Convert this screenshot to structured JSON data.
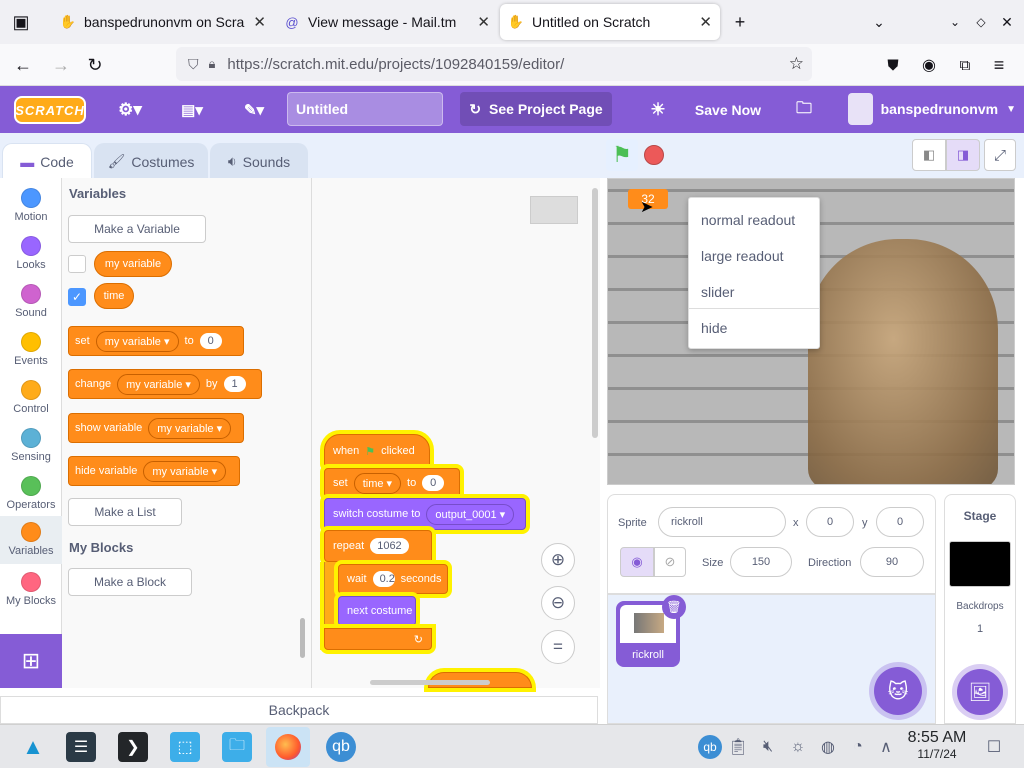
{
  "browser": {
    "tabs": [
      {
        "label": "banspedrunonvm on Scra",
        "icon": "scratch-tab-icon",
        "active": false
      },
      {
        "label": "View message - Mail.tm",
        "icon": "mail-tab-icon",
        "active": false
      },
      {
        "label": "Untitled on Scratch",
        "icon": "scratch-tab-icon",
        "active": true
      }
    ],
    "url": "https://scratch.mit.edu/projects/1092840159/editor/"
  },
  "menubar": {
    "logo": "SCRATCH",
    "project_title": "Untitled",
    "see_project_page": "See Project Page",
    "save_now": "Save Now",
    "username": "banspedrunonvm"
  },
  "editor_tabs": [
    "Code",
    "Costumes",
    "Sounds"
  ],
  "categories": [
    {
      "label": "Motion",
      "color": "#4c97ff"
    },
    {
      "label": "Looks",
      "color": "#9966ff"
    },
    {
      "label": "Sound",
      "color": "#cf63cf"
    },
    {
      "label": "Events",
      "color": "#ffbf00"
    },
    {
      "label": "Control",
      "color": "#ffab19"
    },
    {
      "label": "Sensing",
      "color": "#5cb1d6"
    },
    {
      "label": "Operators",
      "color": "#59c059"
    },
    {
      "label": "Variables",
      "color": "#ff8c1a"
    },
    {
      "label": "My Blocks",
      "color": "#ff6680"
    }
  ],
  "palette": {
    "variables_heading": "Variables",
    "make_variable": "Make a Variable",
    "var1": "my variable",
    "var2": "time",
    "set_block": {
      "word": "set",
      "var": "my variable",
      "to": "to",
      "value": "0"
    },
    "change_block": {
      "word": "change",
      "var": "my variable",
      "by": "by",
      "value": "1"
    },
    "show_block": {
      "word": "show variable",
      "var": "my variable"
    },
    "hide_block": {
      "word": "hide variable",
      "var": "my variable"
    },
    "make_list": "Make a List",
    "myblocks_heading": "My Blocks",
    "make_block": "Make a Block"
  },
  "script": {
    "when_flag": {
      "when": "when",
      "clicked": "clicked"
    },
    "set_time": {
      "word": "set",
      "var": "time",
      "to": "to",
      "value": "0"
    },
    "switch_costume": {
      "word": "switch costume to",
      "value": "output_0001"
    },
    "repeat": {
      "word": "repeat",
      "value": "1062"
    },
    "wait": {
      "word": "wait",
      "value": "0.2",
      "unit": "seconds"
    },
    "next_costume": "next costume"
  },
  "backpack": "Backpack",
  "stage": {
    "monitor_value": "32",
    "context_menu": [
      "normal readout",
      "large readout",
      "slider",
      "hide"
    ]
  },
  "sprite_info": {
    "sprite_label": "Sprite",
    "sprite_name": "rickroll",
    "x_label": "x",
    "x": "0",
    "y_label": "y",
    "y": "0",
    "size_label": "Size",
    "size": "150",
    "direction_label": "Direction",
    "direction": "90"
  },
  "sprites": [
    {
      "name": "rickroll"
    }
  ],
  "stage_pane": {
    "title": "Stage",
    "backdrops_label": "Backdrops",
    "backdrops_count": "1"
  },
  "taskbar": {
    "time": "8:55 AM",
    "date": "11/7/24"
  },
  "colors": {
    "scratch_purple": "#855cd6",
    "variables_orange": "#ff8c1a",
    "glow_yellow": "#fff200"
  }
}
